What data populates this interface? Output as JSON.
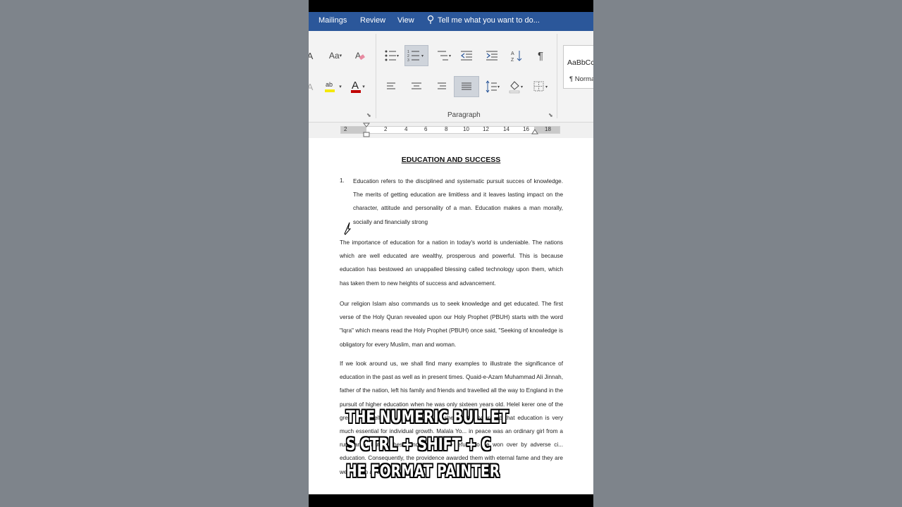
{
  "ribbon_tabs": [
    "Mailings",
    "Review",
    "View"
  ],
  "tell_me": "Tell me what you want to do...",
  "font_group": {
    "change_case": "Aa",
    "font_color_letter": "A",
    "highlight_letters": "ab",
    "accent_red": "#c00000",
    "accent_yellow": "#f4e80b"
  },
  "paragraph_group_label": "Paragraph",
  "styles": {
    "preview": "AaBbCcD",
    "name": "¶ Normal"
  },
  "ruler_labels": [
    "2",
    "2",
    "4",
    "6",
    "8",
    "10",
    "12",
    "14",
    "16",
    "18"
  ],
  "document": {
    "title": "EDUCATION AND SUCCESS",
    "list_number": "1.",
    "paragraphs": [
      "Education refers to the disciplined and systematic pursuit succes of knowledge. The merits of getting education are limitless and it leaves lasting impact on the character, attitude and personality of a man. Education makes a man morally, socially and financially strong",
      "The importance of education for a nation in today's world is undeniable. The nations which are well educated are wealthy, prosperous and powerful. This is because education has bestowed an unappalled blessing called technology upon them, which has taken them to new heights of success and advancement.",
      "Our religion Islam also commands us to seek knowledge and get educated. The first verse of the Holy Quran revealed upon our Holy Prophet (PBUH) starts with the word \"Iqra\" which means read the Holy Prophet (PBUH) once said, \"Seeking of knowledge is obligatory for every Muslim, man and woman.",
      "If we look around us, we shall find many examples to illustrate the significance of education in the past as well as in present times. Quaid-e-Azam Muhammad Ali Jinnah, father of the nation, left his family and friends and travelled all the way to England in the pursuit of higher education when he was only sixteen years old. Helel kerer one of the great ... herself blind but even though she practically proved that education is very much essential for individual growth. Malala Yo... in peace was an ordinary girl from a rural area. But all these and many more refuse to be won over by adverse ci... education. Consequently, the providence awarded them with eternal fame and they are well known all over the world."
    ]
  },
  "caption_lines": [
    "THE NUMERIC BULLET",
    "S CTRL + SHIFT + C",
    "HE FORMAT PAINTER"
  ]
}
